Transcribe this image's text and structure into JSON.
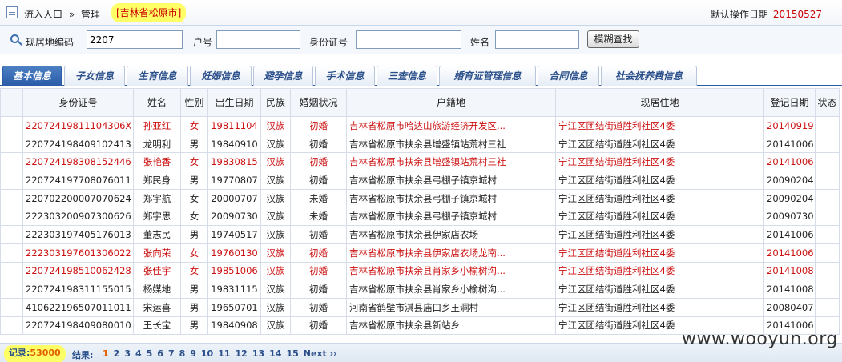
{
  "breadcrumb": {
    "part1": "流入人口",
    "sep": "»",
    "part2": "管理",
    "city": "[吉林省松原市]"
  },
  "op_date": {
    "label": "默认操作日期",
    "value": "20150527"
  },
  "search": {
    "addr_code_label": "现居地编码",
    "addr_code_value": "2207",
    "household_label": "户号",
    "household_value": "",
    "id_label": "身份证号",
    "id_value": "",
    "name_label": "姓名",
    "name_value": "",
    "button": "模糊查找"
  },
  "tabs": [
    "基本信息",
    "子女信息",
    "生育信息",
    "妊娠信息",
    "避孕信息",
    "手术信息",
    "三查信息",
    "婚育证管理信息",
    "合同信息",
    "社会抚养费信息"
  ],
  "table": {
    "headers": [
      "身份证号",
      "姓名",
      "性别",
      "出生日期",
      "民族",
      "婚姻状况",
      "户籍地",
      "现居住地",
      "登记日期",
      "状态"
    ],
    "rows": [
      {
        "id": "22072419811104306X",
        "name": "孙亚红",
        "sex": "女",
        "birth": "19811104",
        "nation": "汉族",
        "marital": "初婚",
        "hukou": "吉林省松原市哈达山旅游经济开发区...",
        "residence": "宁江区团结街道胜利社区4委",
        "reg": "20140919",
        "status": "",
        "red": true
      },
      {
        "id": "220724198409102413",
        "name": "龙明利",
        "sex": "男",
        "birth": "19840910",
        "nation": "汉族",
        "marital": "初婚",
        "hukou": "吉林省松原市扶余县增盛镇站荒村三社",
        "residence": "宁江区团结街道胜利社区4委",
        "reg": "20141006",
        "status": "",
        "red": false
      },
      {
        "id": "220724198308152446",
        "name": "张艳香",
        "sex": "女",
        "birth": "19830815",
        "nation": "汉族",
        "marital": "初婚",
        "hukou": "吉林省松原市扶余县增盛镇站荒村三社",
        "residence": "宁江区团结街道胜利社区4委",
        "reg": "20141006",
        "status": "",
        "red": true
      },
      {
        "id": "220724197708076011",
        "name": "郑民身",
        "sex": "男",
        "birth": "19770807",
        "nation": "汉族",
        "marital": "初婚",
        "hukou": "吉林省松原市扶余县弓棚子镇京城村",
        "residence": "宁江区团结街道胜利社区4委",
        "reg": "20090204",
        "status": "",
        "red": false
      },
      {
        "id": "220702200007070624",
        "name": "郑宇航",
        "sex": "女",
        "birth": "20000707",
        "nation": "汉族",
        "marital": "未婚",
        "hukou": "吉林省松原市扶余县弓棚子镇京城村",
        "residence": "宁江区团结街道胜利社区4委",
        "reg": "20090204",
        "status": "",
        "red": false
      },
      {
        "id": "222303200907300626",
        "name": "郑宇思",
        "sex": "女",
        "birth": "20090730",
        "nation": "汉族",
        "marital": "未婚",
        "hukou": "吉林省松原市扶余县弓棚子镇京城村",
        "residence": "宁江区团结街道胜利社区4委",
        "reg": "20090730",
        "status": "",
        "red": false
      },
      {
        "id": "222303197405176013",
        "name": "董志民",
        "sex": "男",
        "birth": "19740517",
        "nation": "汉族",
        "marital": "初婚",
        "hukou": "吉林省松原市扶余县伊家店农场",
        "residence": "宁江区团结街道胜利社区4委",
        "reg": "20141006",
        "status": "",
        "red": false
      },
      {
        "id": "222303197601306022",
        "name": "张向荣",
        "sex": "女",
        "birth": "19760130",
        "nation": "汉族",
        "marital": "初婚",
        "hukou": "吉林省松原市扶余县伊家店农场龙南...",
        "residence": "宁江区团结街道胜利社区4委",
        "reg": "20141006",
        "status": "",
        "red": true
      },
      {
        "id": "220724198510062428",
        "name": "张佳宇",
        "sex": "女",
        "birth": "19851006",
        "nation": "汉族",
        "marital": "初婚",
        "hukou": "吉林省松原市扶余县肖家乡小榆树沟...",
        "residence": "宁江区团结街道胜利社区4委",
        "reg": "20141008",
        "status": "",
        "red": true
      },
      {
        "id": "220724198311155015",
        "name": "杨媒地",
        "sex": "男",
        "birth": "19831115",
        "nation": "汉族",
        "marital": "初婚",
        "hukou": "吉林省松原市扶余县肖家乡小榆树沟...",
        "residence": "宁江区团结街道胜利社区4委",
        "reg": "20141008",
        "status": "",
        "red": false
      },
      {
        "id": "410622196507011011",
        "name": "宋运喜",
        "sex": "男",
        "birth": "19650701",
        "nation": "汉族",
        "marital": "初婚",
        "hukou": "河南省鹤壁市淇县庙口乡王洞村",
        "residence": "宁江区团结街道胜利社区4委",
        "reg": "20080407",
        "status": "",
        "red": false
      },
      {
        "id": "220724198409080010",
        "name": "王长宝",
        "sex": "男",
        "birth": "19840908",
        "nation": "汉族",
        "marital": "初婚",
        "hukou": "吉林省松原市扶余县新站乡",
        "residence": "宁江区团结街道胜利社区4委",
        "reg": "20141006",
        "status": "",
        "red": false
      }
    ]
  },
  "pager": {
    "records_label": "记录:",
    "records_value": "53000",
    "result_label": "结果:",
    "pages": [
      "1",
      "2",
      "3",
      "4",
      "5",
      "6",
      "7",
      "8",
      "9",
      "10",
      "11",
      "12",
      "13",
      "14",
      "15"
    ],
    "next": "Next ››"
  },
  "watermark": "www.wooyun.org",
  "colors": {
    "accent": "#2a5ca8",
    "highlight": "#ffff66",
    "red_text": "#cc1111"
  }
}
